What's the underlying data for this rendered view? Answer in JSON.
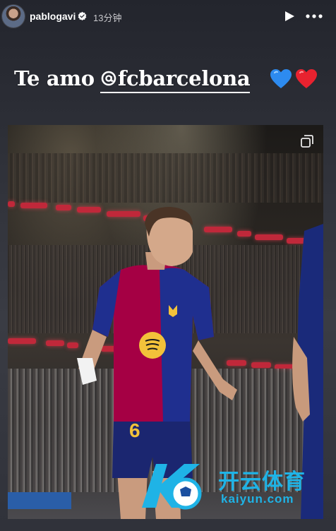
{
  "header": {
    "username": "pablogavi",
    "time_ago": "13分钟",
    "icons": [
      "avatar",
      "verified-badge-icon",
      "play-icon",
      "more-icon"
    ]
  },
  "story": {
    "caption_text": "Te amo",
    "mention": "fcbarcelona",
    "emojis": [
      "blue-heart",
      "red-heart"
    ],
    "colors": {
      "blue_heart": "#2d8bf0",
      "red_heart": "#e8222f",
      "accent_blaugrana_red": "#a50044",
      "accent_blaugrana_blue": "#1a2a7a"
    }
  },
  "photo": {
    "subject": "footballer",
    "shirt_number": "6",
    "watermark": {
      "cn": "开云体育",
      "en": "kaiyun.com"
    },
    "icons": [
      "copy-icon"
    ]
  }
}
